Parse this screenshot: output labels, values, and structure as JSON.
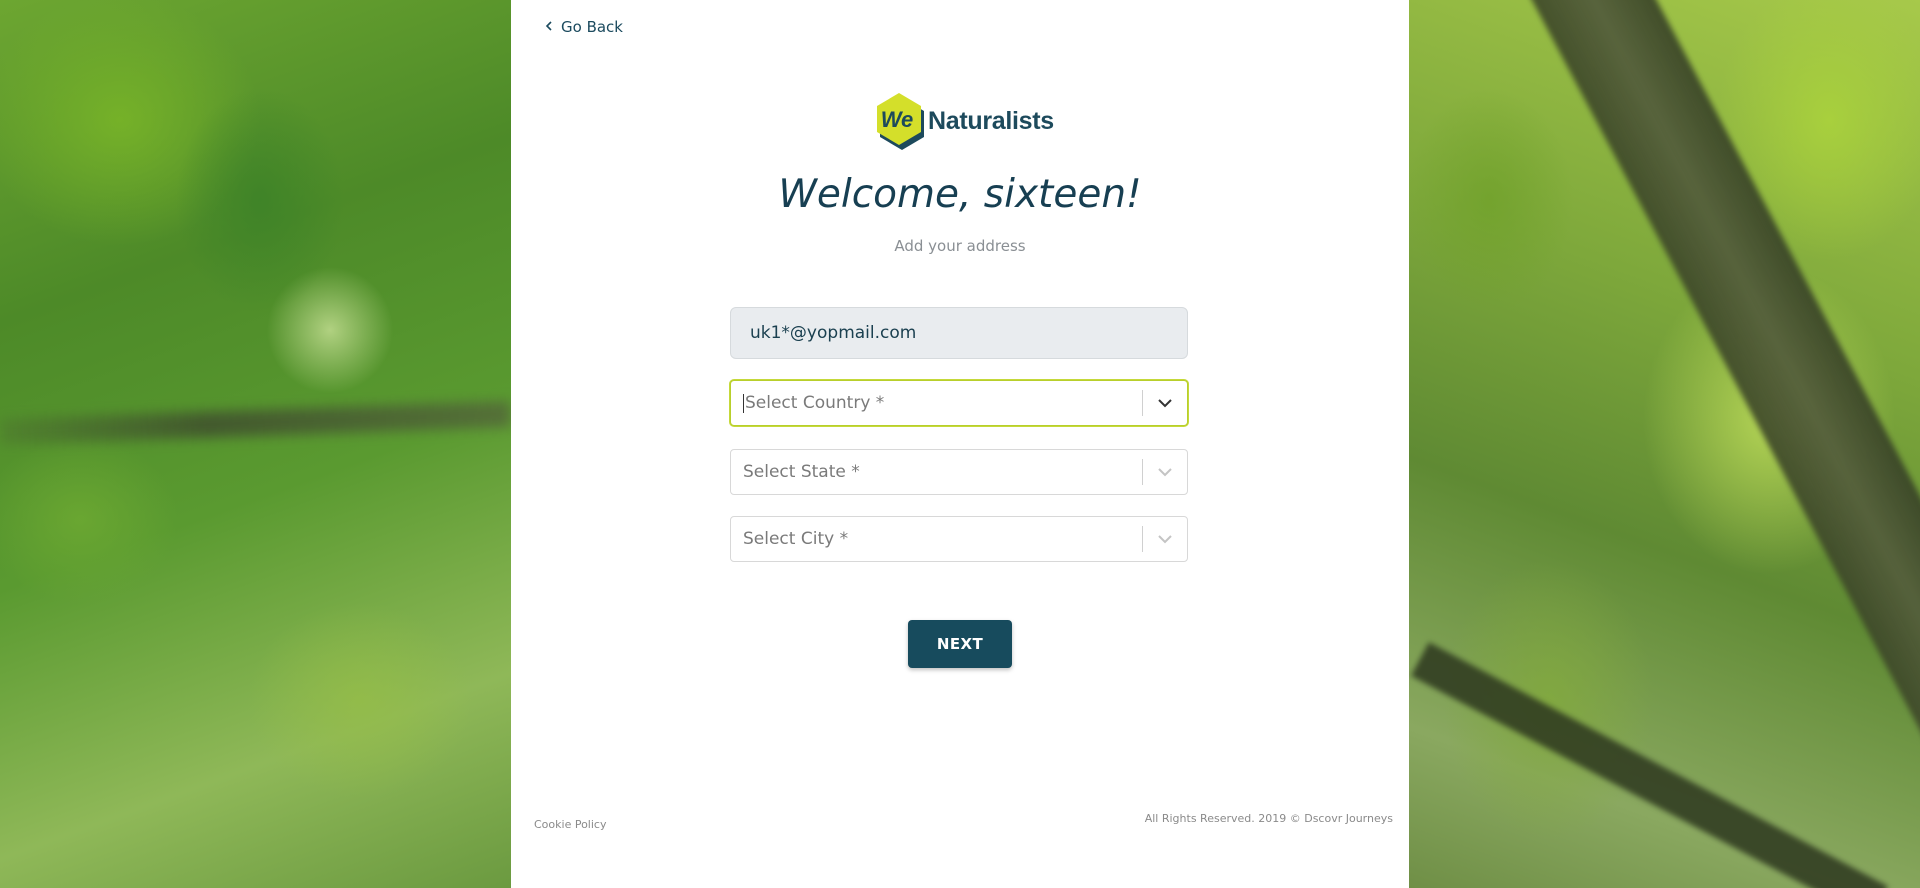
{
  "nav": {
    "back_label": "Go Back"
  },
  "logo": {
    "badge_text": "We",
    "word": "Naturalists"
  },
  "header": {
    "title": "Welcome, sixteen!",
    "subtitle": "Add your address"
  },
  "form": {
    "email_value": "uk1*@yopmail.com",
    "country_placeholder": "Select Country *",
    "state_placeholder": "Select State *",
    "city_placeholder": "Select City *",
    "next_label": "NEXT"
  },
  "footer": {
    "cookie_label": "Cookie Policy",
    "rights_text": "All Rights Reserved. 2019 © Dscovr Journeys"
  },
  "colors": {
    "brand_dark": "#174b5d",
    "brand_yellow": "#d4df2a",
    "focus_border": "#b8cf2c"
  },
  "icons": {
    "back": "chevron-left-icon",
    "dropdown": "chevron-down-icon"
  }
}
